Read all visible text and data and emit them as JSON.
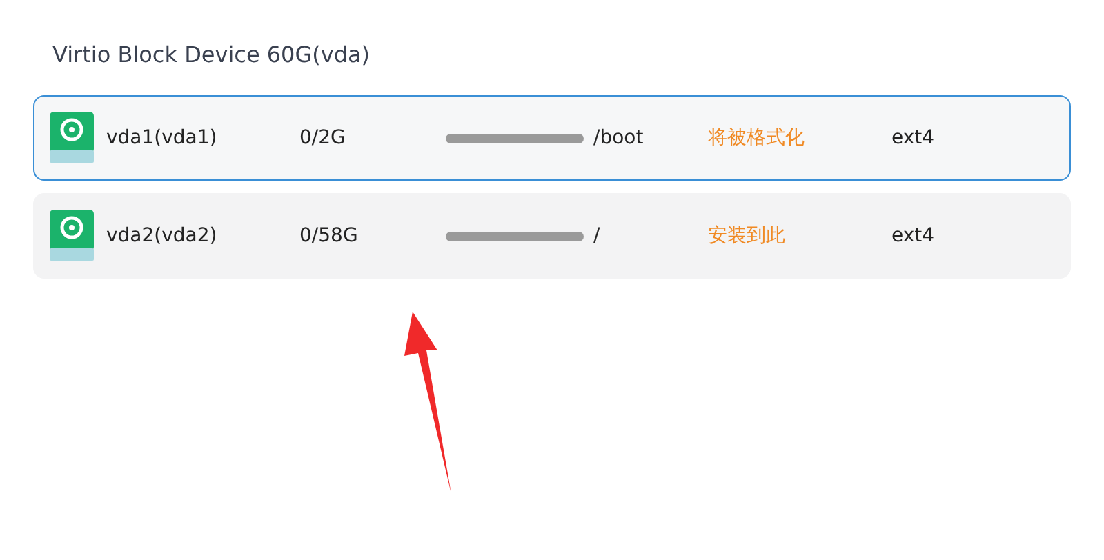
{
  "disk": {
    "title": "Virtio Block Device 60G(vda)"
  },
  "partitions": [
    {
      "name": "vda1(vda1)",
      "size": "0/2G",
      "mount": "/boot",
      "status": "将被格式化",
      "filesystem": "ext4",
      "selected": true
    },
    {
      "name": "vda2(vda2)",
      "size": "0/58G",
      "mount": "/",
      "status": "安装到此",
      "filesystem": "ext4",
      "selected": false
    }
  ]
}
